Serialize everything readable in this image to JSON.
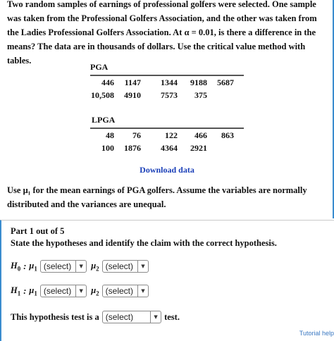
{
  "problem": {
    "intro": "Two random samples of earnings of professional golfers were selected. One sample was taken from the Professional Golfers Association, and the other was taken from the Ladies Professional Golfers Association. At α = 0.01, is there a difference in the means? The data are in thousands of dollars. Use the critical value method with tables.",
    "pga_label": "PGA",
    "pga_rows": [
      [
        "446",
        "1147",
        "1344",
        "9188",
        "5687"
      ],
      [
        "10,508",
        "4910",
        "7573",
        "375",
        ""
      ]
    ],
    "lpga_label": "LPGA",
    "lpga_rows": [
      [
        "48",
        "76",
        "122",
        "466",
        "863"
      ],
      [
        "100",
        "1876",
        "4364",
        "2921",
        ""
      ]
    ],
    "download_label": "Download data",
    "use_text": "Use μ₁ for the mean earnings of PGA golfers. Assume the variables are normally distributed and the variances are unequal."
  },
  "part": {
    "title": "Part 1 out of 5",
    "instruction": "State the hypotheses and identify the claim with the correct hypothesis.",
    "h0_symbol": "H",
    "h0_sub": "0",
    "h1_symbol": "H",
    "h1_sub": "1",
    "colon": ":",
    "mu": "μ",
    "mu1_sub": "1",
    "mu2_sub": "2",
    "select_placeholder": "(select)",
    "test_prefix": "This hypothesis test is a",
    "test_suffix": "test."
  },
  "footer": {
    "tutorial_label": "Tutorial help"
  }
}
